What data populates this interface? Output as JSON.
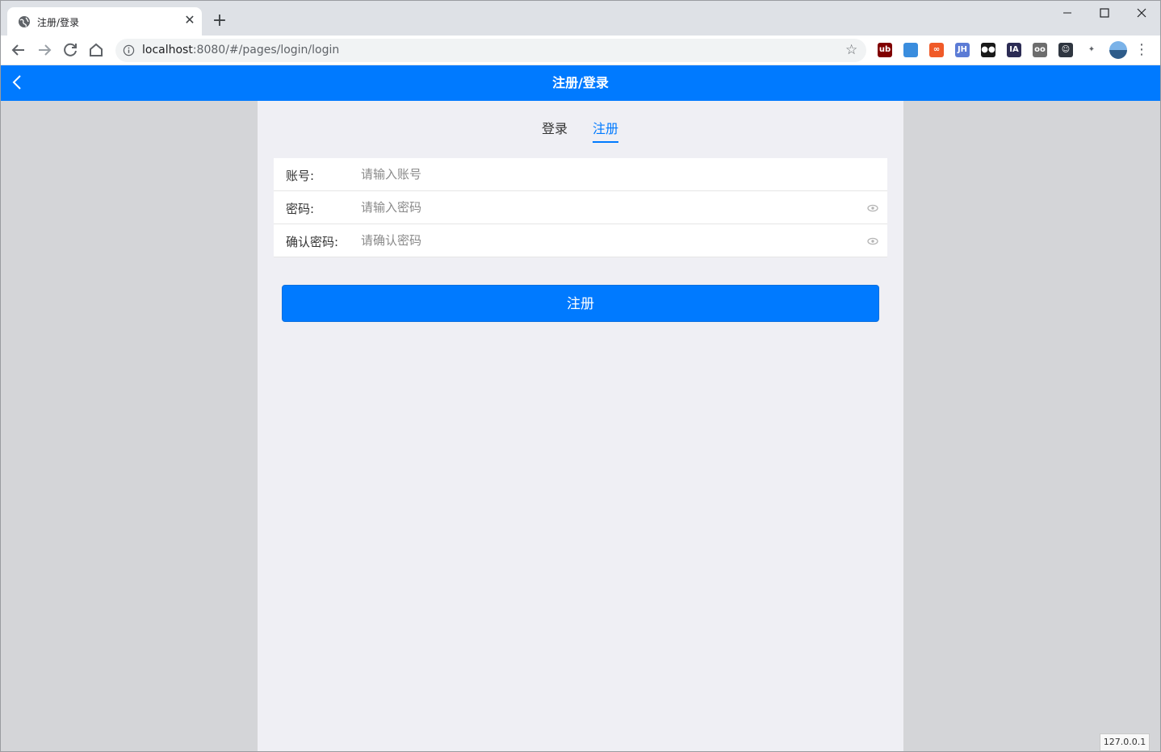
{
  "browser": {
    "tab_title": "注册/登录",
    "url_host": "localhost",
    "url_rest": ":8080/#/pages/login/login",
    "colors": {
      "tabstrip": "#dee1e6",
      "omnibox": "#f1f3f4"
    },
    "extensions": [
      {
        "name": "ublock-icon",
        "text": "ub",
        "color": "#800000"
      },
      {
        "name": "shield-ext-icon",
        "text": "",
        "color": "#3a8dde"
      },
      {
        "name": "infinity-ext-icon",
        "text": "∞",
        "color": "#f05a28"
      },
      {
        "name": "jh-ext-icon",
        "text": "JH",
        "color": "#5b7bd5"
      },
      {
        "name": "mask-ext-icon",
        "text": "●●",
        "color": "#1a1a1a"
      },
      {
        "name": "ia-ext-icon",
        "text": "IA",
        "color": "#2c2c54"
      },
      {
        "name": "owl-ext-icon",
        "text": "oo",
        "color": "#6d6d6d"
      },
      {
        "name": "face-ext-icon",
        "text": "☺",
        "color": "#2f3640"
      },
      {
        "name": "puzzle-icon",
        "text": "",
        "color": "#5f6368"
      }
    ]
  },
  "app": {
    "header_title": "注册/登录",
    "accent": "#007aff",
    "tabs": {
      "login": "登录",
      "register": "注册"
    },
    "fields": [
      {
        "label": "账号:",
        "placeholder": "请输入账号"
      },
      {
        "label": "密码:",
        "placeholder": "请输入密码"
      },
      {
        "label": "确认密码:",
        "placeholder": "请确认密码"
      }
    ],
    "submit_label": "注册"
  },
  "status_bubble": "127.0.0.1"
}
